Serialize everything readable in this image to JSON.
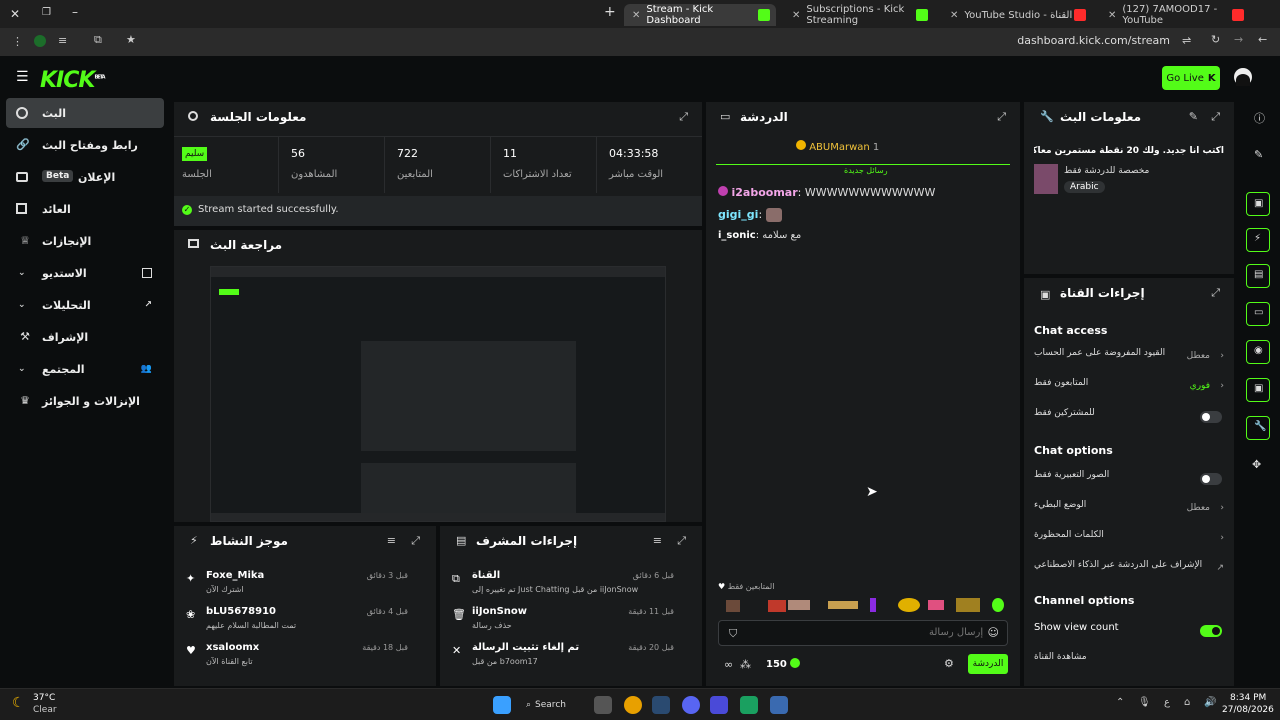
{
  "browser": {
    "tabs": [
      {
        "title": "Stream - Kick Dashboard",
        "active": true
      },
      {
        "title": "Subscriptions - Kick Streaming",
        "active": false
      },
      {
        "title": "YouTube Studio - محتوى القناة",
        "active": false
      },
      {
        "title": "(127) 7AMOOD17 - YouTube",
        "active": false
      }
    ],
    "url": "dashboard.kick.com/stream"
  },
  "header": {
    "logo": "KICK",
    "logo_sup": "BETA",
    "go_live": "Go Live"
  },
  "nav": {
    "items": [
      {
        "label": "البث",
        "active": true
      },
      {
        "label": "رابط ومفتاح البث"
      },
      {
        "label": "الإعلان",
        "badge": "Beta"
      },
      {
        "label": "العائد"
      },
      {
        "label": "الإنجازات"
      },
      {
        "label": "الاستديو"
      },
      {
        "label": "التحليلات"
      },
      {
        "label": "الإشراف"
      },
      {
        "label": "المجتمع"
      },
      {
        "label": "الإنزالات و الجوائز"
      }
    ]
  },
  "session": {
    "title": "معلومات الجلسة",
    "badge": "سليم",
    "badge_label": "الجلسة",
    "stats": [
      {
        "value": "56",
        "label": "المشاهدون"
      },
      {
        "value": "722",
        "label": "المتابعين"
      },
      {
        "value": "11",
        "label": "تعداد الاشتراكات"
      },
      {
        "value": "04:33:58",
        "label": "الوقت مباشر"
      }
    ],
    "status": "Stream started successfully."
  },
  "preview": {
    "title": "مراجعة البث"
  },
  "activity": {
    "title": "موجز النشاط",
    "rows": [
      {
        "name": "Foxe_Mika",
        "sub": "اشترك الآن",
        "time": "قبل 3 دقائق",
        "icon": "star-icon"
      },
      {
        "name": "bLU5678910",
        "sub": "تمت المطالبة السلام عليهم",
        "time": "قبل 4 دقائق",
        "icon": "gift-icon"
      },
      {
        "name": "xsaloomx",
        "sub": "تابع القناة الآن",
        "time": "قبل 18 دقيقة",
        "icon": "heart-icon"
      }
    ]
  },
  "modactions": {
    "title": "إجراءات المشرف",
    "rows": [
      {
        "name": "القناة",
        "sub": "تم تغييره إلى Just Chatting من قبل iiJonSnow",
        "time": "قبل 6 دقائق",
        "icon": "category-icon"
      },
      {
        "name": "iiJonSnow",
        "sub": "حذف رسالة",
        "time": "قبل 11 دقيقة",
        "icon": "trash-icon"
      },
      {
        "name": "تم إلغاء تثبيت الرسالة",
        "sub": "من قبل b7oom17",
        "time": "قبل 20 دقيقة",
        "icon": "unpin-icon"
      }
    ]
  },
  "chat": {
    "title": "الدردشة",
    "pinned_user": "ABUMarwan",
    "pinned_count": "1",
    "new_messages": "رسائل جديدة",
    "messages": [
      {
        "user": "i2aboomar",
        "text": "WWWWWWWWWWWW",
        "color": "#f3a6e8"
      },
      {
        "user": "gigi_gi",
        "text": "",
        "color": "#7ee7ff"
      },
      {
        "user": "i_sonic",
        "text": "مع سلامه",
        "color": "#ffffff"
      }
    ],
    "followers_only": "المتابعين فقط",
    "input_placeholder": "إرسال رسالة",
    "points": "150",
    "send": "الدردشة"
  },
  "streaminfo": {
    "title": "معلومات البث",
    "stream_title": "اكتب انا جديد. ولك 20 نقطة مستمرين معاكم #63",
    "category": "مخصصة للدردشة فقط",
    "language": "Arabic"
  },
  "channelactions": {
    "title": "إجراءات القناة",
    "chat_access": "Chat access",
    "access_rows": [
      {
        "label": "القيود المفروضة على عمر الحساب",
        "value": "معطل"
      },
      {
        "label": "المتابعون فقط",
        "value": "فوري"
      },
      {
        "label": "للمشتركين فقط",
        "value": ""
      }
    ],
    "chat_options": "Chat options",
    "option_rows": [
      {
        "label": "الصور التعبيرية فقط",
        "value": ""
      },
      {
        "label": "الوضع البطيء",
        "value": "معطل"
      },
      {
        "label": "الكلمات المحظورة",
        "value": ""
      },
      {
        "label": "الإشراف على الدردشة عبر الذكاء الاصطناعي",
        "value": ""
      }
    ],
    "channel_options": "Channel options",
    "show_view_count": "Show view count",
    "watch_channel": "مشاهدة القناة"
  },
  "taskbar": {
    "weather_temp": "37°C",
    "weather_desc": "Clear",
    "search": "Search",
    "time": "8:34 PM",
    "date": "27/08/2026"
  },
  "colors": {
    "accent": "#53fc18",
    "panel": "#191b1c",
    "bg": "#0b0d0e"
  }
}
